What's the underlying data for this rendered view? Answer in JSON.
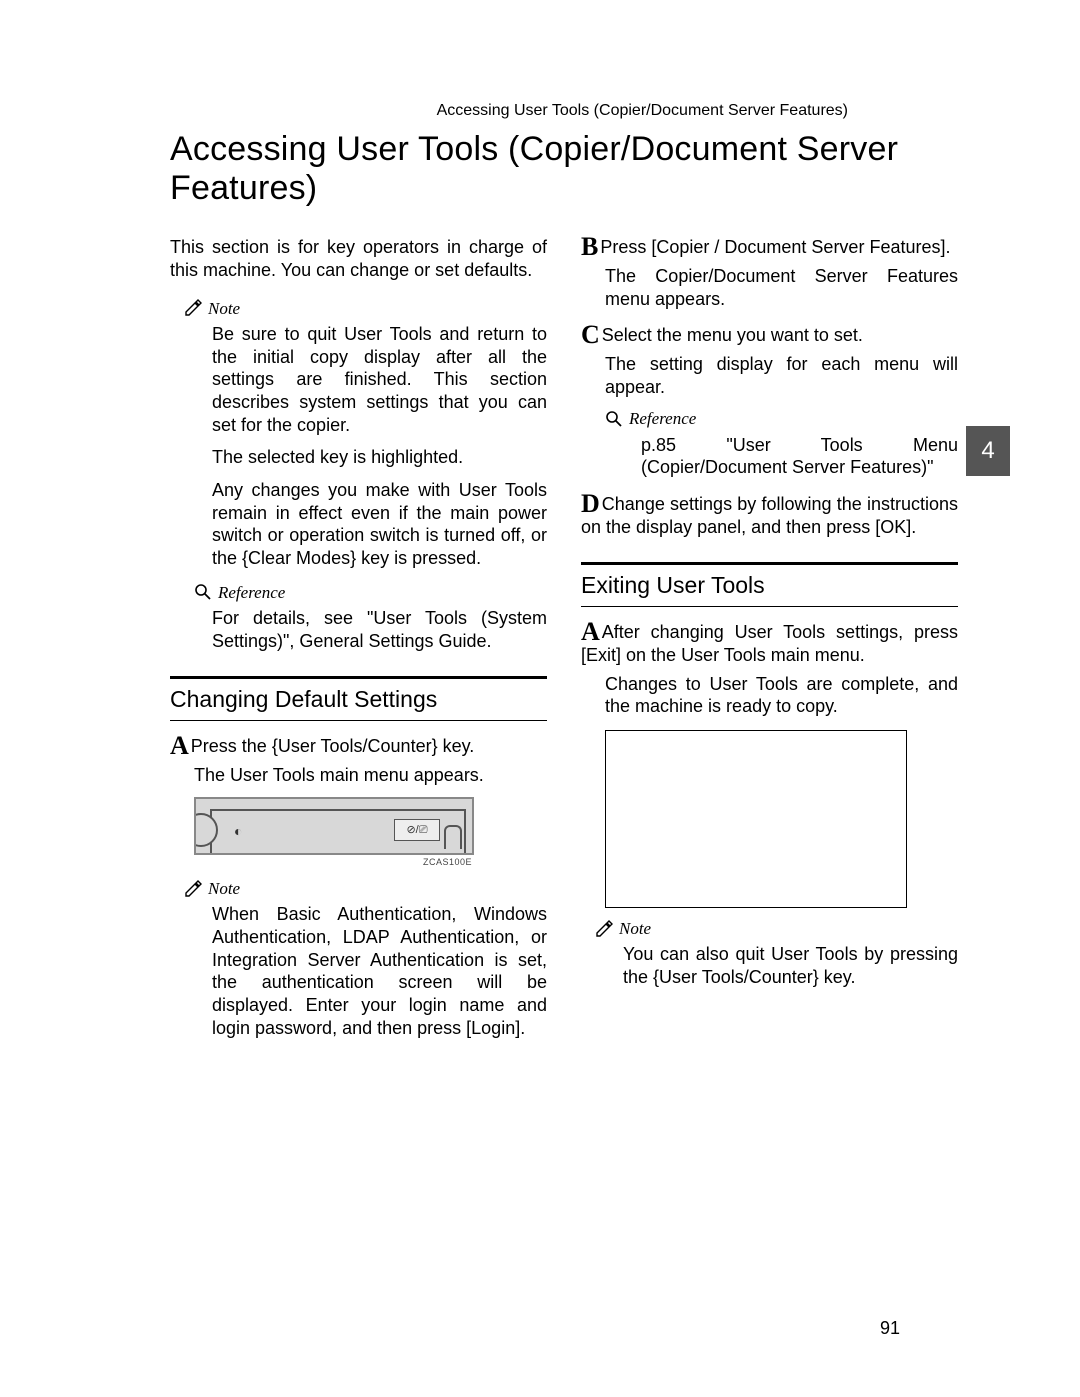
{
  "running_header": "Accessing User Tools (Copier/Document Server Features)",
  "chapter_tab": "4",
  "title": "Accessing User Tools (Copier/Document Server Features)",
  "intro": "This section is for key operators in charge of this machine. You can change or set defaults.",
  "labels": {
    "note": "Note",
    "reference": "Reference"
  },
  "note1": {
    "p1": "Be sure to quit User Tools and return to the initial copy display after all the settings are finished. This section describes system settings that you can set for the copier.",
    "p2": "The selected key is highlighted.",
    "p3_a": "Any changes you make with User Tools remain in effect even if the main power switch or operation switch is turned off, or the ",
    "p3_key": "{Clear Modes}",
    "p3_b": " key is pressed."
  },
  "reference1": "For details, see \"User Tools (System Settings)\", General Settings Guide.",
  "section_changing": "Changing Default Settings",
  "stepA": {
    "letter": "A",
    "pre": "Press the ",
    "key": "{User Tools/Counter}",
    "post": " key."
  },
  "stepA_sub": "The User Tools main menu appears.",
  "figure_code": "ZCAS100E",
  "note2": {
    "pre": "When Basic Authentication, Windows Authentication, LDAP Authentication, or Integration Server Authentication is set, the authentication screen will be displayed. Enter your login name and login password, and then press ",
    "btn": "[Login]",
    "post": "."
  },
  "stepB": {
    "letter": "B",
    "pre": "Press ",
    "btn": "[Copier / Document Server Features]",
    "post": "."
  },
  "stepB_sub": "The Copier/Document Server Features menu appears.",
  "stepC": {
    "letter": "C",
    "text": "Select the menu you want to set."
  },
  "stepC_sub": "The setting display for each menu will appear.",
  "reference2": "p.85 \"User Tools Menu (Copier/Document Server Features)\"",
  "stepD": {
    "letter": "D",
    "pre": "Change settings by following the instructions on the display panel, and then press ",
    "btn": "[OK]",
    "post": "."
  },
  "section_exit": "Exiting User Tools",
  "exit_stepA": {
    "letter": "A",
    "pre": "After changing User Tools settings, press ",
    "btn": "[Exit]",
    "post": " on the User Tools main menu."
  },
  "exit_sub": "Changes to User Tools are complete, and the machine is ready to copy.",
  "note3": {
    "pre": "You can also quit User Tools by pressing the ",
    "key": "{User Tools/Counter}",
    "post": " key."
  },
  "page_number": "91"
}
